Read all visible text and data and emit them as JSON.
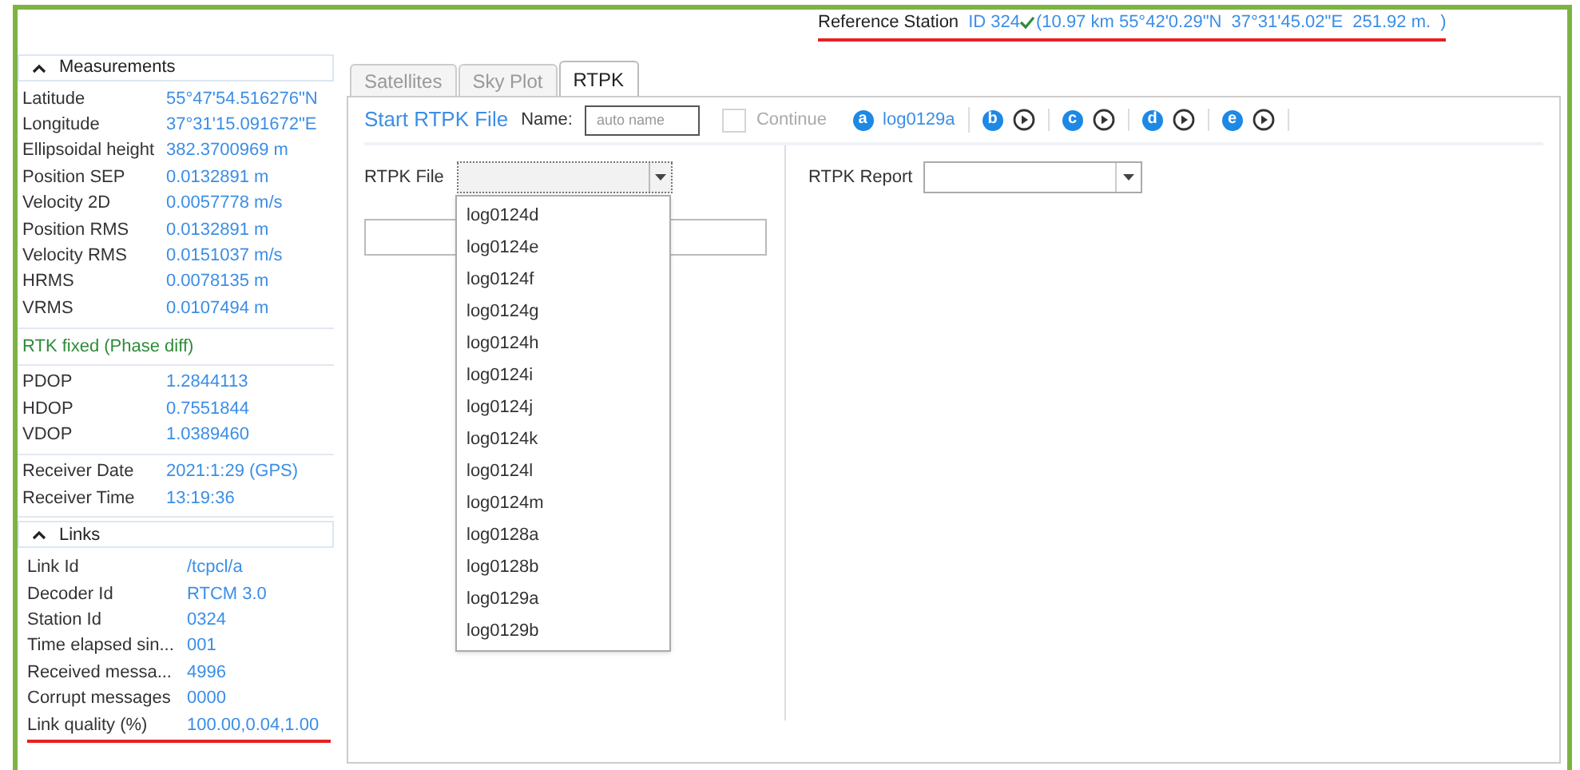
{
  "reference_station": {
    "label": "Reference Station",
    "id": "ID 324",
    "verified": true,
    "detail": "(10.97 km 55°42'0.29\"N  37°31'45.02\"E  251.92 m.  )"
  },
  "measurements": {
    "title": "Measurements",
    "expanded": true,
    "groups": [
      {
        "kind": "rows",
        "rows": [
          {
            "label": "Latitude",
            "value": "55°47'54.516276\"N"
          },
          {
            "label": "Longitude",
            "value": "37°31'15.091672\"E"
          },
          {
            "label": "Ellipsoidal height",
            "value": "382.3700969 m"
          },
          {
            "label": "Position SEP",
            "value": "0.0132891 m"
          },
          {
            "label": "Velocity 2D",
            "value": "0.0057778 m/s"
          },
          {
            "label": "Position RMS",
            "value": "0.0132891 m"
          },
          {
            "label": "Velocity RMS",
            "value": "0.0151037 m/s"
          },
          {
            "label": "HRMS",
            "value": "0.0078135 m"
          },
          {
            "label": "VRMS",
            "value": "0.0107494 m"
          }
        ]
      },
      {
        "kind": "status",
        "text": "RTK fixed (Phase diff)"
      },
      {
        "kind": "rows",
        "rows": [
          {
            "label": "PDOP",
            "value": "1.2844113"
          },
          {
            "label": "HDOP",
            "value": "0.7551844"
          },
          {
            "label": "VDOP",
            "value": "1.0389460"
          }
        ]
      },
      {
        "kind": "rows",
        "rows": [
          {
            "label": "Receiver Date",
            "value": "2021:1:29 (GPS)"
          },
          {
            "label": "Receiver Time",
            "value": "13:19:36"
          }
        ]
      }
    ]
  },
  "links": {
    "title": "Links",
    "expanded": true,
    "rows": [
      {
        "label": "Link Id",
        "value": "/tcpcl/a"
      },
      {
        "label": "Decoder Id",
        "value": "RTCM 3.0"
      },
      {
        "label": "Station Id",
        "value": "0324"
      },
      {
        "label": "Time elapsed sin...",
        "value": "001"
      },
      {
        "label": "Received messa...",
        "value": "4996"
      },
      {
        "label": "Corrupt messages",
        "value": "0000"
      },
      {
        "label": "Link quality (%)",
        "value": "100.00,0.04,1.00"
      }
    ]
  },
  "tabs": [
    {
      "label": "Satellites",
      "selected": false
    },
    {
      "label": "Sky Plot",
      "selected": false
    },
    {
      "label": "RTPK",
      "selected": true
    }
  ],
  "toolbar": {
    "start": "Start RTPK File",
    "name_label": "Name:",
    "name_placeholder": "auto name",
    "continue": {
      "label": "Continue",
      "checked": false,
      "disabled": true
    },
    "slots": [
      {
        "letter": "a",
        "kind": "file",
        "file": "log0129a"
      },
      {
        "letter": "b",
        "kind": "play"
      },
      {
        "letter": "c",
        "kind": "play"
      },
      {
        "letter": "d",
        "kind": "play"
      },
      {
        "letter": "e",
        "kind": "play"
      }
    ]
  },
  "rtpk_file": {
    "label": "RTPK File",
    "expanded": true,
    "options": [
      "log0124d",
      "log0124e",
      "log0124f",
      "log0124g",
      "log0124h",
      "log0124i",
      "log0124j",
      "log0124k",
      "log0124l",
      "log0124m",
      "log0128a",
      "log0128b",
      "log0129a",
      "log0129b"
    ]
  },
  "rtpk_report": {
    "label": "RTPK Report"
  }
}
